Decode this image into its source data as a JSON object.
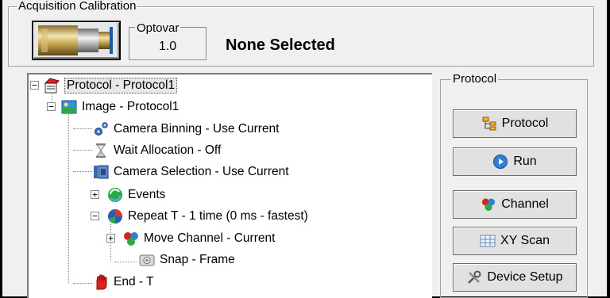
{
  "calibration": {
    "group_title": "Acquisition Calibration",
    "optovar_label": "Optovar",
    "optovar_value": "1.0",
    "selection_status": "None Selected"
  },
  "tree": {
    "items": [
      {
        "label": "Protocol - Protocol1",
        "icon": "protocol-icon"
      },
      {
        "label": "Image - Protocol1",
        "icon": "image-icon"
      },
      {
        "label": "Camera Binning - Use Current",
        "icon": "binning-icon"
      },
      {
        "label": "Wait Allocation - Off",
        "icon": "hourglass-icon"
      },
      {
        "label": "Camera Selection - Use Current",
        "icon": "camera-selection-icon"
      },
      {
        "label": "Events",
        "icon": "events-icon"
      },
      {
        "label": "Repeat T - 1 time (0 ms - fastest)",
        "icon": "repeat-icon"
      },
      {
        "label": "Move Channel - Current",
        "icon": "channel-icon"
      },
      {
        "label": "Snap - Frame",
        "icon": "camera-icon"
      },
      {
        "label": "End - T",
        "icon": "hand-stop-icon"
      }
    ]
  },
  "protocol_panel": {
    "title": "Protocol",
    "buttons": [
      {
        "label": "Protocol",
        "icon": "protocol-tree-icon"
      },
      {
        "label": "Run",
        "icon": "play-icon"
      },
      {
        "label": "Channel",
        "icon": "channel-icon"
      },
      {
        "label": "XY Scan",
        "icon": "grid-icon"
      },
      {
        "label": "Device Setup",
        "icon": "tools-icon"
      }
    ]
  },
  "colors": {
    "run_blue": "#2f7fd4",
    "stop_red": "#e0201a",
    "events_green": "#2aa84a"
  }
}
